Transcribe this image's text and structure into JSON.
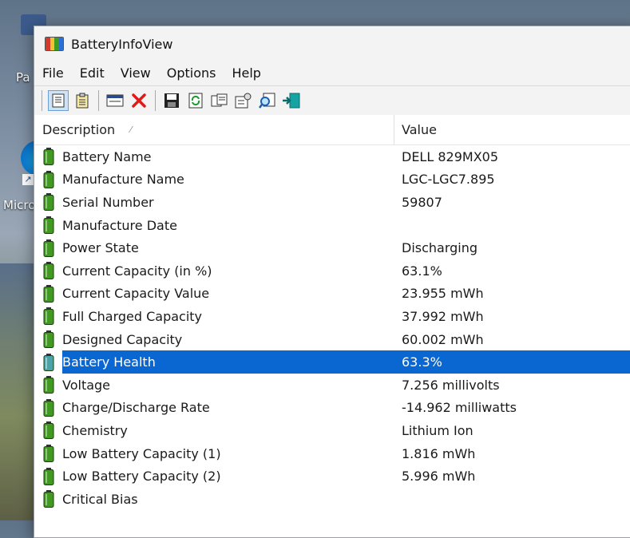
{
  "desktop": {
    "label_top": "Pa",
    "label_edge": "Micro"
  },
  "window": {
    "title": "BatteryInfoView"
  },
  "menu": [
    "File",
    "Edit",
    "View",
    "Options",
    "Help"
  ],
  "toolbar": {
    "buttons": [
      "properties-icon",
      "report-icon",
      "window-icon",
      "delete-icon",
      "save-icon",
      "refresh-icon",
      "copy-icon",
      "options-icon",
      "find-icon",
      "exit-icon"
    ]
  },
  "columns": {
    "description": "Description",
    "value": "Value"
  },
  "rows": [
    {
      "description": "Battery Name",
      "value": "DELL 829MX05"
    },
    {
      "description": "Manufacture Name",
      "value": "LGC-LGC7.895"
    },
    {
      "description": "Serial Number",
      "value": "59807"
    },
    {
      "description": "Manufacture Date",
      "value": ""
    },
    {
      "description": "Power State",
      "value": "Discharging"
    },
    {
      "description": "Current Capacity (in %)",
      "value": "63.1%"
    },
    {
      "description": "Current Capacity Value",
      "value": "23.955 mWh"
    },
    {
      "description": "Full Charged Capacity",
      "value": "37.992 mWh"
    },
    {
      "description": "Designed Capacity",
      "value": "60.002 mWh"
    },
    {
      "description": "Battery Health",
      "value": "63.3%"
    },
    {
      "description": "Voltage",
      "value": "7.256 millivolts"
    },
    {
      "description": "Charge/Discharge Rate",
      "value": "-14.962 milliwatts"
    },
    {
      "description": "Chemistry",
      "value": "Lithium Ion"
    },
    {
      "description": "Low Battery Capacity (1)",
      "value": "1.816 mWh"
    },
    {
      "description": "Low Battery Capacity (2)",
      "value": "5.996 mWh"
    },
    {
      "description": "Critical Bias",
      "value": ""
    }
  ],
  "selected_row": "Battery Health",
  "colors": {
    "selection": "#0a66d1",
    "battery_green": "#3f9a1f"
  }
}
